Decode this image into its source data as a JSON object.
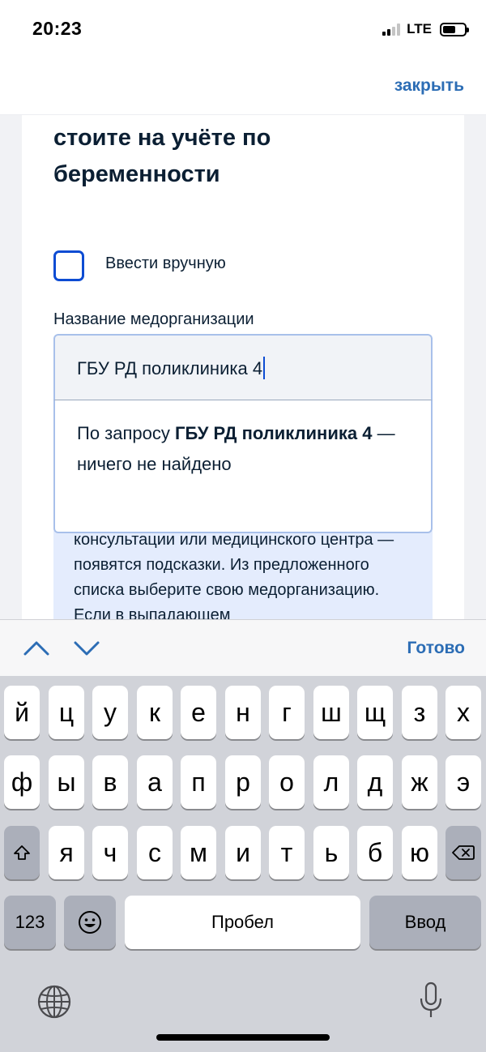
{
  "status_bar": {
    "time": "20:23",
    "network": "LTE"
  },
  "header": {
    "close_label": "закрыть"
  },
  "form": {
    "title": "стоите на учёте по беременности",
    "manual_checkbox_label": "Ввести вручную",
    "field_label": "Название медорганизации",
    "input_value": "ГБУ РД поликлиника 4",
    "no_results": {
      "prefix": "По запросу ",
      "query": "ГБУ РД поликлиника 4",
      "suffix": " — ничего не найдено"
    },
    "hint_text": "консультации или медицинского центра — появятся подсказки. Из предложенного списка выберите свою медорганизацию. Если в выпадающем"
  },
  "keyboard_toolbar": {
    "done_label": "Готово"
  },
  "keyboard": {
    "row1": [
      "й",
      "ц",
      "у",
      "к",
      "е",
      "н",
      "г",
      "ш",
      "щ",
      "з",
      "х"
    ],
    "row2": [
      "ф",
      "ы",
      "в",
      "а",
      "п",
      "р",
      "о",
      "л",
      "д",
      "ж",
      "э"
    ],
    "row3": [
      "я",
      "ч",
      "с",
      "м",
      "и",
      "т",
      "ь",
      "б",
      "ю"
    ],
    "numbers_label": "123",
    "space_label": "Пробел",
    "return_label": "Ввод"
  }
}
